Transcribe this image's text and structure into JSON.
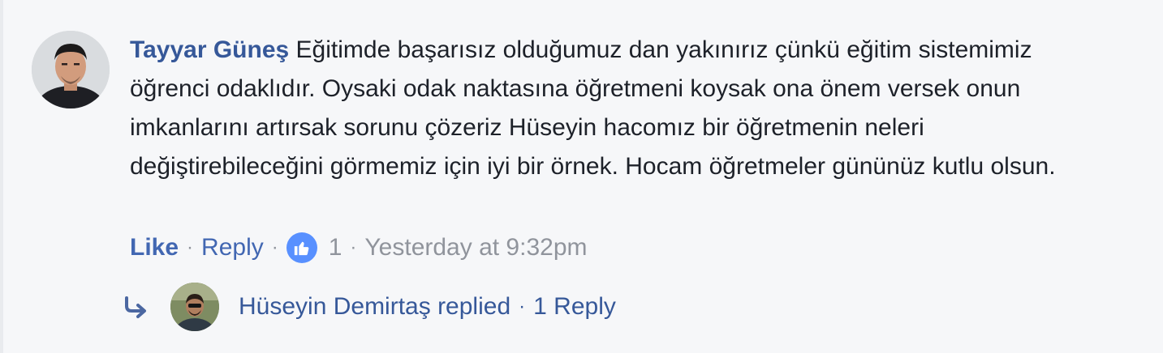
{
  "comment": {
    "author": "Tayyar Güneş",
    "text": "Eğitimde başarısız olduğumuz dan yakınırız çünkü eğitim sistemimiz öğrenci odaklıdır. Oysaki odak naktasına öğretmeni koysak ona önem versek onun imkanlarını artırsak sorunu çözeriz Hüseyin hacomız bir öğretmenin neleri değiştirebileceğini görmemiz için iyi bir örnek. Hocam öğretmeler gününüz kutlu olsun.",
    "actions": {
      "like_label": "Like",
      "reply_label": "Reply",
      "reaction_count": "1",
      "timestamp": "Yesterday at 9:32pm"
    },
    "replies": {
      "replier_text": "Hüseyin Demirtaş replied",
      "count_text": "1 Reply"
    }
  },
  "colors": {
    "link": "#365899",
    "like": "#4267b2",
    "meta": "#90949c",
    "text": "#1d2129",
    "background": "#f6f7f9",
    "like_badge": "#5890ff"
  }
}
